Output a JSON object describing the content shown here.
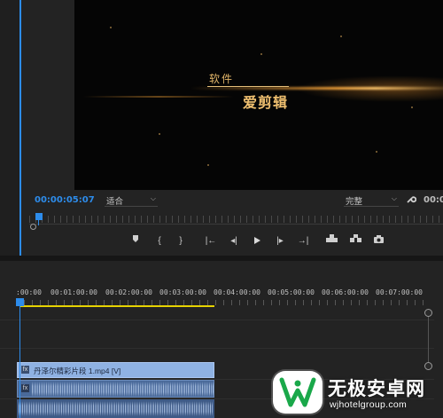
{
  "program_monitor": {
    "video_overlay": {
      "line1": "软件",
      "line2": "爱剪辑"
    },
    "timecode": "00:00:05:07",
    "fit_select": {
      "value": "适合"
    },
    "quality_select": {
      "value": "完整"
    },
    "right_timecode": "00:00",
    "transport_buttons": [
      {
        "name": "add-marker",
        "glyph": "⬢"
      },
      {
        "name": "mark-in",
        "glyph": "{"
      },
      {
        "name": "mark-out",
        "glyph": "}"
      },
      {
        "name": "go-to-in",
        "glyph": "|←"
      },
      {
        "name": "step-back",
        "glyph": "◂|"
      },
      {
        "name": "play",
        "glyph": "▶"
      },
      {
        "name": "step-forward",
        "glyph": "|▸"
      },
      {
        "name": "go-to-out",
        "glyph": "→|"
      },
      {
        "name": "lift",
        "glyph": "⬒"
      },
      {
        "name": "extract",
        "glyph": "⬓"
      },
      {
        "name": "export-frame",
        "glyph": "◙"
      }
    ]
  },
  "timeline": {
    "ruler_labels": [
      ":00:00",
      "00:01:00:00",
      "00:02:00:00",
      "00:03:00:00",
      "00:04:00:00",
      "00:05:00:00",
      "00:06:00:00",
      "00:07:00:00"
    ],
    "video_clip": {
      "fx": "fx",
      "name": "丹泽尔精彩片段 1.mp4 [V]"
    },
    "audio_clip": {
      "fx": "fx"
    }
  },
  "watermark": {
    "title": "无极安卓网",
    "url": "wjhotelgroup.com"
  },
  "colors": {
    "accent": "#2d8ceb",
    "work_area": "#e6d200",
    "video_clip": "#8fb2e3",
    "audio_clip": "#4a6a9a"
  },
  "icons": [
    "wrench-icon",
    "play-icon",
    "marker-icon",
    "camera-icon",
    "fx-icon",
    "playhead-icon"
  ]
}
